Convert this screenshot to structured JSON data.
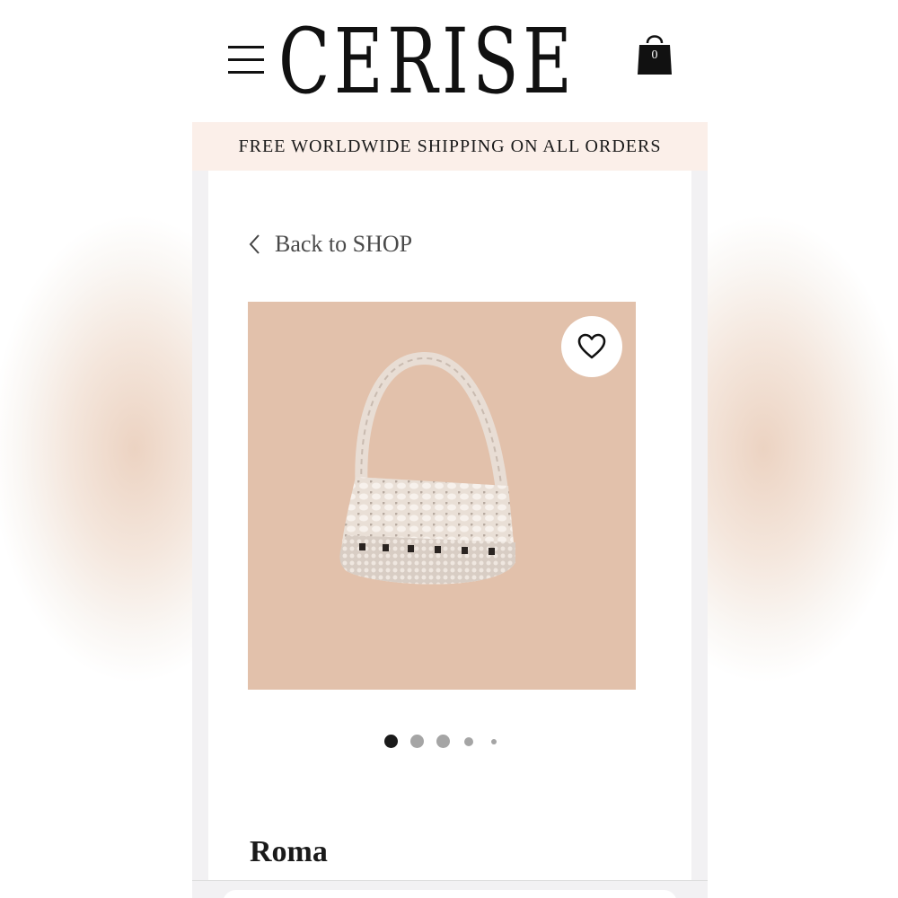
{
  "header": {
    "logo_text": "CERISE",
    "cart_count": "0",
    "menu_icon": "hamburger-menu-icon",
    "cart_icon": "shopping-bag-icon"
  },
  "banner": {
    "text": "FREE WORLDWIDE SHIPPING ON ALL ORDERS",
    "background": "#fbefe9"
  },
  "navigation": {
    "back_label": "Back to SHOP",
    "back_icon": "chevron-left-icon"
  },
  "product": {
    "name": "Roma",
    "image_background": "#e2c1ab",
    "image_subject": "crochet-shoulder-bag",
    "wishlist_icon": "heart-icon"
  },
  "carousel": {
    "total_slides": 5,
    "active_index": 0
  },
  "colors": {
    "text_primary": "#111111",
    "active_dot": "#1a1a1a",
    "inactive_dot": "#a5a5a5"
  }
}
